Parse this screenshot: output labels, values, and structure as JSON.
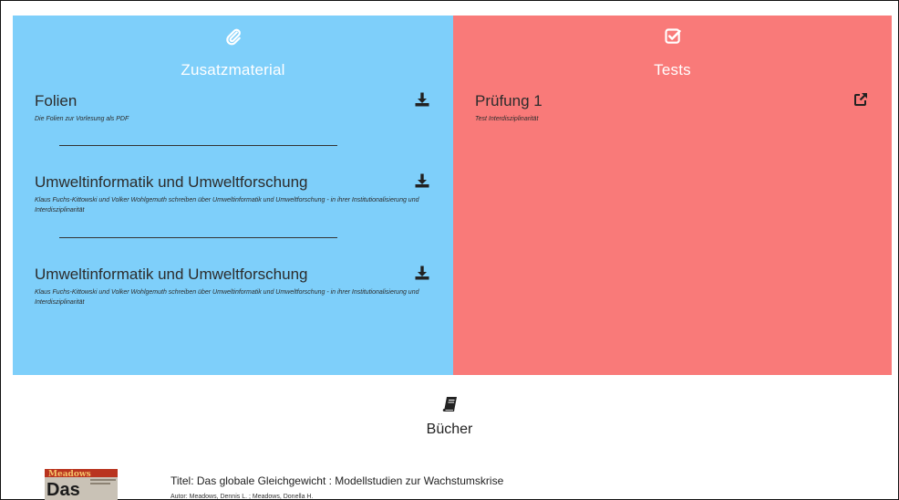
{
  "colors": {
    "left_panel": "#7ecffa",
    "right_panel": "#f97a79",
    "icon_dark": "#222222"
  },
  "zusatzmaterial": {
    "icon": "paperclip-icon",
    "title": "Zusatzmaterial",
    "items": [
      {
        "title": "Folien",
        "description": "Die Folien zur Vorlesung als PDF",
        "action_icon": "download-icon"
      },
      {
        "title": "Umweltinformatik und Umweltforschung",
        "description": "Klaus Fuchs-Kittowski und Volker Wohlgemuth schreiben über Umweltinformatik und Umweltforschung - in ihrer Institutionalisierung und Interdisziplinarität",
        "action_icon": "download-icon"
      },
      {
        "title": "Umweltinformatik und Umweltforschung",
        "description": "Klaus Fuchs-Kittowski und Volker Wohlgemuth schreiben über Umweltinformatik und Umweltforschung - in ihrer Institutionalisierung und Interdisziplinarität",
        "action_icon": "download-icon"
      }
    ]
  },
  "tests": {
    "icon": "checkbox-icon",
    "title": "Tests",
    "items": [
      {
        "title": "Prüfung 1",
        "description": "Test Interdisziplinarität",
        "action_icon": "external-link-icon"
      }
    ]
  },
  "books": {
    "icon": "book-icon",
    "title": "Bücher",
    "items": [
      {
        "cover_text_top": "Meadows",
        "cover_text_big": "Das",
        "title": "Titel: Das globale Gleichgewicht : Modellstudien zur Wachstumskrise",
        "author": "Autor: Meadows, Dennis L. ; Meadows, Donella H."
      }
    ]
  }
}
